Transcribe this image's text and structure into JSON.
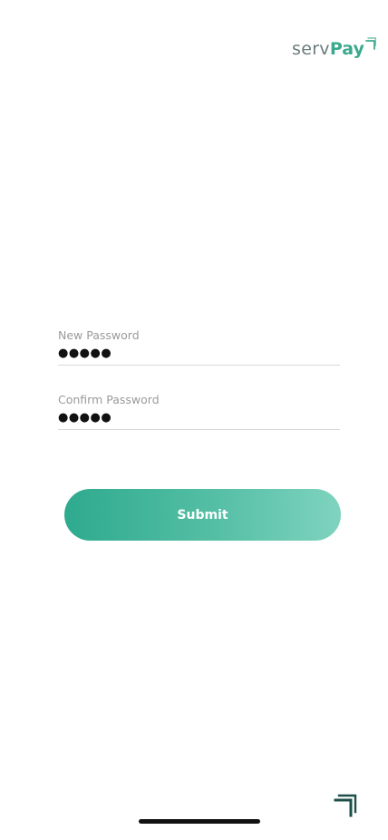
{
  "brand": {
    "serv": "serv",
    "pay": "Pay",
    "primary_color": "#3aa98e",
    "text_color": "#6b7a7a"
  },
  "form": {
    "new_password": {
      "label": "New Password",
      "value": "●●●●●"
    },
    "confirm_password": {
      "label": "Confirm Password",
      "value": "●●●●●"
    },
    "submit_label": "Submit"
  },
  "icons": {
    "logo_mark": "brand-arrow-mark-icon",
    "corner_mark": "brand-arrow-mark-icon"
  },
  "colors": {
    "button_gradient_start": "#2eaa8e",
    "button_gradient_end": "#7fd3bf",
    "corner_mark": "#1d4f4a"
  }
}
